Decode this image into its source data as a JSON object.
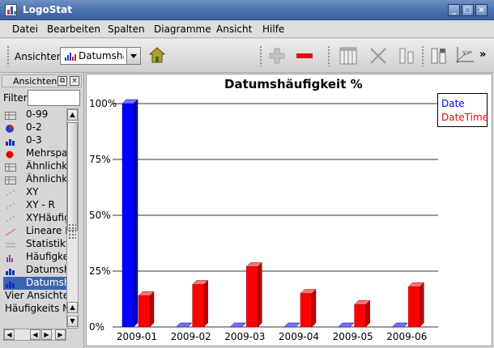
{
  "window": {
    "title": "LogoStat",
    "controls": [
      "_",
      "□",
      "×"
    ]
  },
  "menu": [
    "Datei",
    "Bearbeiten",
    "Spalten",
    "Diagramme",
    "Ansicht",
    "Hilfe"
  ],
  "toolbar": {
    "views_label": "Ansichten",
    "views_combo_value": "Datumshä",
    "overflow_label": "»",
    "icons": [
      "house-icon",
      "plus-icon",
      "minus-icon",
      "columns-icon",
      "delete-column-icon",
      "split-column-icon",
      "bar-chart-icon",
      "formula-chart-icon"
    ]
  },
  "side_panel": {
    "title": "Ansichten",
    "filter_label": "Filter",
    "filter_value": "",
    "items": [
      {
        "label": "0-99",
        "icon": "table-icon"
      },
      {
        "label": "0-2",
        "icon": "pie-chart-icon"
      },
      {
        "label": "0-3",
        "icon": "bar-chart-icon"
      },
      {
        "label": "Mehrspa",
        "icon": "red-dot-icon"
      },
      {
        "label": "Ähnlichk",
        "icon": "table-icon"
      },
      {
        "label": "Ähnlichk",
        "icon": "table-icon"
      },
      {
        "label": "XY",
        "icon": "scatter-icon"
      },
      {
        "label": "XY - R",
        "icon": "scatter-icon"
      },
      {
        "label": "XYHäufig",
        "icon": "scatter-icon"
      },
      {
        "label": "Lineare F",
        "icon": "line-icon"
      },
      {
        "label": "Statistikta",
        "icon": "stats-icon"
      },
      {
        "label": "Häufigke",
        "icon": "histogram-icon"
      },
      {
        "label": "Datumsh",
        "icon": "bar-chart-icon"
      },
      {
        "label": "Datumsh",
        "icon": "bar-chart-icon",
        "selected": true
      },
      {
        "label": "Vier Ansichte",
        "icon": ""
      },
      {
        "label": "Häufigkeits N",
        "icon": ""
      }
    ]
  },
  "chart_data": {
    "type": "bar",
    "title": "Datumshäufigkeit %",
    "xlabel": "",
    "ylabel": "",
    "categories": [
      "2009-01",
      "2009-02",
      "2009-03",
      "2009-04",
      "2009-05",
      "2009-06"
    ],
    "series": [
      {
        "name": "Date",
        "color": "#0000ff",
        "values": [
          100,
          0,
          0,
          0,
          0,
          0
        ]
      },
      {
        "name": "DateTime",
        "color": "#ff0000",
        "values": [
          14,
          19,
          27,
          15,
          10,
          18
        ]
      }
    ],
    "ylim": [
      0,
      100
    ],
    "y_ticks": [
      "0%",
      "25%",
      "50%",
      "75%",
      "100%"
    ],
    "grid": true,
    "legend_position": "top-right"
  }
}
